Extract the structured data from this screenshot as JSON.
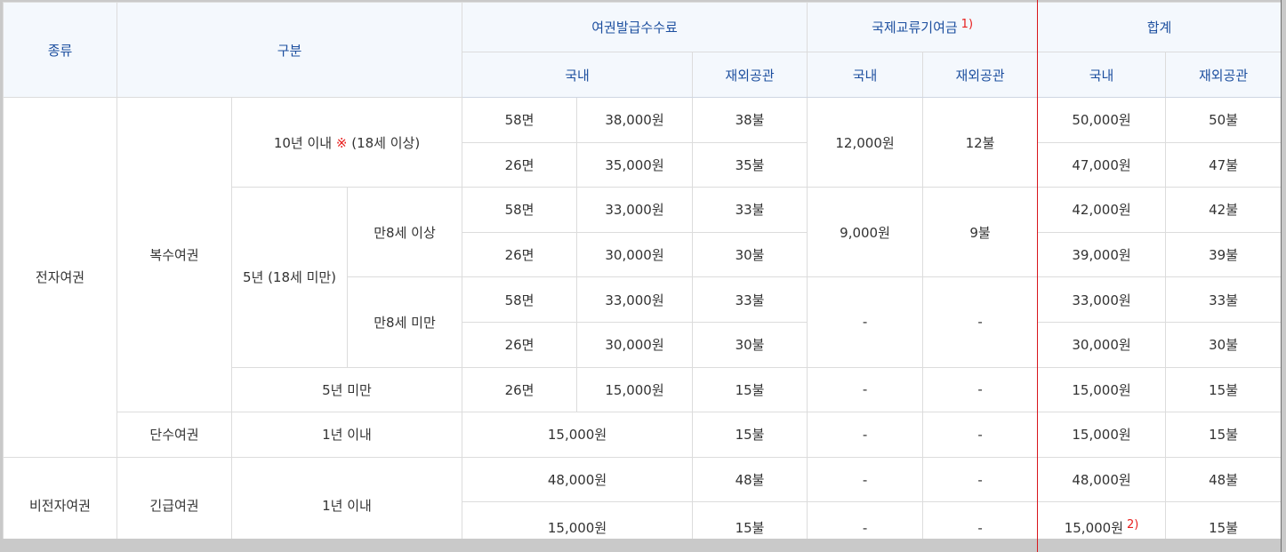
{
  "header": {
    "type": "종류",
    "category": "구분",
    "issuance_fee": "여권발급수수료",
    "contribution": "국제교류기여금",
    "contribution_note": "1)",
    "total": "합계",
    "issuance_domestic": "국내",
    "issuance_overseas": "재외공관",
    "contribution_domestic": "국내",
    "contribution_overseas": "재외공관",
    "total_domestic": "국내",
    "total_overseas": "재외공관"
  },
  "kinds": {
    "electronic": "전자여권",
    "non_electronic": "비전자여권"
  },
  "passport_types": {
    "multiple": "복수여권",
    "single": "단수여권",
    "emergency": "긴급여권"
  },
  "validity": {
    "ten_years": "10년 이내",
    "ten_years_mark": "※",
    "ten_years_age": "(18세 이상)",
    "five_years": "5년 (18세 미만)",
    "age_8_and_over": "만8세 이상",
    "under_age_8": "만8세 미만",
    "under_five_years": "5년 미만",
    "single_one_year": "1년 이내",
    "emergency_one_year": "1년 이내"
  },
  "rows": [
    {
      "pages": "58면",
      "fee_domestic": "38,000원",
      "fee_overseas": "38불",
      "total_domestic": "50,000원",
      "total_overseas": "50불"
    },
    {
      "pages": "26면",
      "fee_domestic": "35,000원",
      "fee_overseas": "35불",
      "total_domestic": "47,000원",
      "total_overseas": "47불"
    },
    {
      "pages": "58면",
      "fee_domestic": "33,000원",
      "fee_overseas": "33불",
      "total_domestic": "42,000원",
      "total_overseas": "42불"
    },
    {
      "pages": "26면",
      "fee_domestic": "30,000원",
      "fee_overseas": "30불",
      "total_domestic": "39,000원",
      "total_overseas": "39불"
    },
    {
      "pages": "58면",
      "fee_domestic": "33,000원",
      "fee_overseas": "33불",
      "total_domestic": "33,000원",
      "total_overseas": "33불"
    },
    {
      "pages": "26면",
      "fee_domestic": "30,000원",
      "fee_overseas": "30불",
      "total_domestic": "30,000원",
      "total_overseas": "30불"
    },
    {
      "pages": "26면",
      "fee_domestic": "15,000원",
      "fee_overseas": "15불",
      "total_domestic": "15,000원",
      "total_overseas": "15불"
    },
    {
      "fee": "15,000원",
      "fee_overseas": "15불",
      "total_domestic": "15,000원",
      "total_overseas": "15불"
    },
    {
      "fee": "48,000원",
      "fee_overseas": "48불",
      "total_domestic": "48,000원",
      "total_overseas": "48불"
    },
    {
      "fee": "15,000원",
      "fee_overseas": "15불",
      "total_domestic": "15,000원",
      "total_domestic_note": "2)",
      "total_overseas": "15불"
    }
  ],
  "contribution": [
    {
      "domestic": "12,000원",
      "overseas": "12불"
    },
    {
      "domestic": "9,000원",
      "overseas": "9불"
    },
    {
      "domestic": "-",
      "overseas": "-"
    },
    {
      "domestic": "-",
      "overseas": "-"
    },
    {
      "domestic": "-",
      "overseas": "-"
    },
    {
      "domestic": "-",
      "overseas": "-"
    },
    {
      "domestic": "-",
      "overseas": "-"
    }
  ],
  "colors": {
    "header_text": "#1d4f9f",
    "header_background": "#f4f8fd",
    "note_red": "#e8201f",
    "total_highlight_line": "#d9161c"
  }
}
